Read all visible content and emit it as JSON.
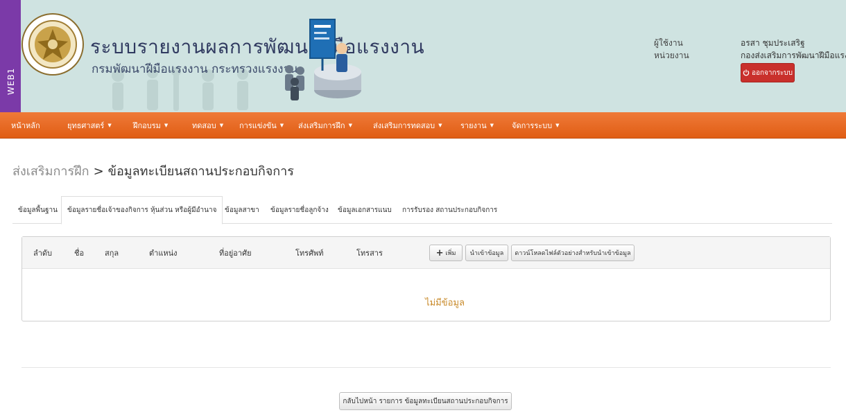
{
  "env_label": "WEB1",
  "header": {
    "title": "ระบบรายงานผลการพัฒนาฝีมือแรงงาน",
    "subtitle": "กรมพัฒนาฝีมือแรงงาน กระทรวงแรงงาน",
    "user_label": "ผู้ใช้งาน",
    "unit_label": "หน่วยงาน",
    "user_name": "อรสา ชุมประเสริฐ",
    "user_unit": "กองส่งเสริมการพัฒนาฝีมือแรงงาน",
    "logout_label": "ออกจากระบบ"
  },
  "nav": {
    "items": [
      {
        "label": "หน้าหลัก",
        "has_caret": false
      },
      {
        "label": "ยุทธศาสตร์",
        "has_caret": true
      },
      {
        "label": "ฝึกอบรม",
        "has_caret": true
      },
      {
        "label": "ทดสอบ",
        "has_caret": true
      },
      {
        "label": "การแข่งขัน",
        "has_caret": true
      },
      {
        "label": "ส่งเสริมการฝึก",
        "has_caret": true
      },
      {
        "label": "ส่งเสริมการทดสอบ",
        "has_caret": true
      },
      {
        "label": "รายงาน",
        "has_caret": true
      },
      {
        "label": "จัดการระบบ",
        "has_caret": true
      }
    ],
    "caret": "▼"
  },
  "breadcrumb": {
    "parent": "ส่งเสริมการฝึก",
    "separator": ">",
    "current": "ข้อมูลทะเบียนสถานประกอบกิจการ"
  },
  "tabs": [
    {
      "label": "ข้อมูลพื้นฐาน",
      "active": false
    },
    {
      "label": "ข้อมูลรายชื่อเจ้าของกิจการ หุ้นส่วน หรือผู้มีอำนาจ",
      "active": true
    },
    {
      "label": "ข้อมูลสาขา",
      "active": false
    },
    {
      "label": "ข้อมูลรายชื่อลูกจ้าง",
      "active": false
    },
    {
      "label": "ข้อมูลเอกสารแนบ",
      "active": false
    },
    {
      "label": "การรับรอง สถานประกอบกิจการ",
      "active": false
    }
  ],
  "table": {
    "columns": [
      "ลำดับ",
      "ชื่อ",
      "สกุล",
      "ตำแหน่ง",
      "ที่อยู่อาศัย",
      "โทรศัพท์",
      "โทรสาร"
    ],
    "buttons": {
      "add": "เพิ่ม",
      "import": "นำเข้าข้อมูล",
      "download_template": "ดาวน์โหลดไฟล์ตัวอย่างสำหรับนำเข้าข้อมูล"
    },
    "empty_message": "ไม่มีข้อมูล"
  },
  "back_button_label": "กลับไปหน้า รายการ ข้อมูลทะเบียนสถานประกอบกิจการ",
  "colors": {
    "navbar": "#e8692a",
    "header_bg": "#cfe3e1",
    "env_strip": "#7b3aa8",
    "logout": "#c9302c",
    "empty_text": "#c88a2a"
  }
}
